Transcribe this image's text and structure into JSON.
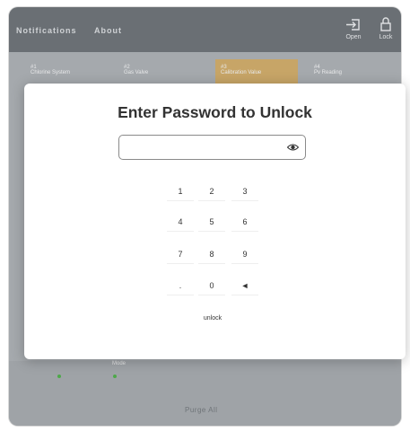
{
  "topbar": {
    "nav": [
      "Notifications",
      "About"
    ],
    "open_label": "Open",
    "lock_label": "Lock"
  },
  "tabs": [
    {
      "num": "#1",
      "label": "Chlorine System"
    },
    {
      "num": "#2",
      "label": "Gas Valve"
    },
    {
      "num": "#3",
      "label": "Calibration Value"
    },
    {
      "num": "#4",
      "label": "Pv Reading"
    }
  ],
  "background": {
    "small_label": "Mode",
    "purge_label": "Purge All"
  },
  "modal": {
    "title": "Enter Password to Unlock",
    "password_value": "",
    "keypad": [
      "1",
      "2",
      "3",
      "4",
      "5",
      "6",
      "7",
      "8",
      "9",
      ".",
      "0",
      "◄"
    ],
    "unlock_label": "unlock"
  },
  "colors": {
    "topbar": "#6a6f74",
    "active_tab": "#c7a567",
    "status_dot": "#4ea84a"
  }
}
